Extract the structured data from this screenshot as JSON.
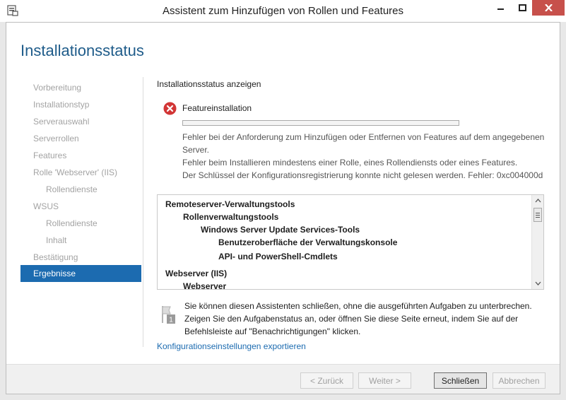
{
  "window": {
    "title": "Assistent zum Hinzufügen von Rollen und Features",
    "close_color": "#c7504b"
  },
  "header": {
    "title": "Installationsstatus"
  },
  "nav": {
    "items": [
      {
        "label": "Vorbereitung",
        "sub": false,
        "active": false
      },
      {
        "label": "Installationstyp",
        "sub": false,
        "active": false
      },
      {
        "label": "Serverauswahl",
        "sub": false,
        "active": false
      },
      {
        "label": "Serverrollen",
        "sub": false,
        "active": false
      },
      {
        "label": "Features",
        "sub": false,
        "active": false
      },
      {
        "label": "Rolle 'Webserver' (IIS)",
        "sub": false,
        "active": false
      },
      {
        "label": "Rollendienste",
        "sub": true,
        "active": false
      },
      {
        "label": "WSUS",
        "sub": false,
        "active": false
      },
      {
        "label": "Rollendienste",
        "sub": true,
        "active": false
      },
      {
        "label": "Inhalt",
        "sub": true,
        "active": false
      },
      {
        "label": "Bestätigung",
        "sub": false,
        "active": false
      },
      {
        "label": "Ergebnisse",
        "sub": false,
        "active": true
      }
    ],
    "accent_color": "#1c6bb0"
  },
  "main": {
    "section_label": "Installationsstatus anzeigen",
    "status_icon": "error-icon",
    "feature_name": "Featureinstallation",
    "progress_fraction": 0,
    "errors": [
      "Fehler bei der Anforderung zum Hinzufügen oder Entfernen von Features auf dem angegebenen Server.",
      "Fehler beim Installieren mindestens einer Rolle, eines Rollendiensts oder eines Features.",
      "Der Schlüssel der Konfigurationsregistrierung konnte nicht gelesen werden. Fehler: 0xc004000d"
    ],
    "tree": [
      {
        "label": "Remoteserver-Verwaltungstools",
        "level": 0
      },
      {
        "label": "Rollenverwaltungstools",
        "level": 1
      },
      {
        "label": "Windows Server Update Services-Tools",
        "level": 2
      },
      {
        "label": "Benutzeroberfläche der Verwaltungskonsole",
        "level": 3
      },
      {
        "label": "API- und PowerShell-Cmdlets",
        "level": 3
      },
      {
        "label": "Webserver (IIS)",
        "level": 0
      },
      {
        "label": "Webserver",
        "level": 1
      }
    ],
    "notice": "Sie können diesen Assistenten schließen, ohne die ausgeführten Aufgaben zu unterbrechen. Zeigen Sie den Aufgabenstatus an, oder öffnen Sie diese Seite erneut, indem Sie auf der Befehlsleiste auf \"Benachrichtigungen\" klicken.",
    "notice_badge": "1",
    "export_link": "Konfigurationseinstellungen exportieren"
  },
  "footer": {
    "back_label": "< Zurück",
    "next_label": "Weiter >",
    "close_label": "Schließen",
    "cancel_label": "Abbrechen"
  }
}
